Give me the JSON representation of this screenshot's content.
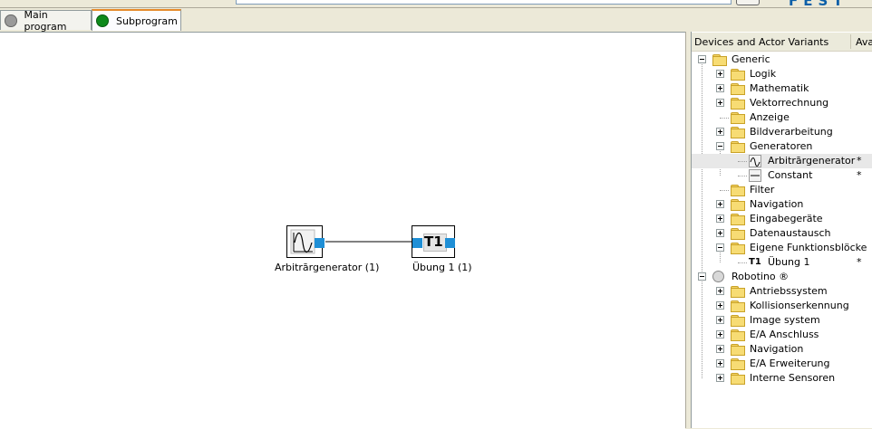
{
  "tabs": [
    {
      "label": "Main program",
      "icon": "gray-circle-icon",
      "color": "#9a9a9a",
      "active": false
    },
    {
      "label": "Subprogram",
      "icon": "green-circle-icon",
      "color": "#0e8a1c",
      "active": true
    }
  ],
  "brand": "FEST",
  "canvas": {
    "blocks": [
      {
        "label": "Arbitrārgenerator (1)",
        "icon": "sine-wave-icon"
      },
      {
        "label": "Übung 1 (1)",
        "icon_text": "T1"
      }
    ]
  },
  "panel": {
    "col1": "Devices and Actor Variants",
    "col2": "Ava",
    "tree": [
      {
        "label": "Generic",
        "depth": 0,
        "state": "expanded",
        "icon": "folder"
      },
      {
        "label": "Logik",
        "depth": 1,
        "state": "collapsed",
        "icon": "folder"
      },
      {
        "label": "Mathematik",
        "depth": 1,
        "state": "collapsed",
        "icon": "folder"
      },
      {
        "label": "Vektorrechnung",
        "depth": 1,
        "state": "collapsed",
        "icon": "folder"
      },
      {
        "label": "Anzeige",
        "depth": 1,
        "state": "leaf",
        "icon": "folder"
      },
      {
        "label": "Bildverarbeitung",
        "depth": 1,
        "state": "collapsed",
        "icon": "folder"
      },
      {
        "label": "Generatoren",
        "depth": 1,
        "state": "expanded",
        "icon": "folder"
      },
      {
        "label": "Arbitrārgenerator",
        "depth": 2,
        "state": "leaf",
        "icon": "sine-device",
        "mark": "*",
        "selected": true
      },
      {
        "label": "Constant",
        "depth": 2,
        "state": "leaf",
        "icon": "constant-device",
        "mark": "*"
      },
      {
        "label": "Filter",
        "depth": 1,
        "state": "leaf",
        "icon": "folder"
      },
      {
        "label": "Navigation",
        "depth": 1,
        "state": "collapsed",
        "icon": "folder"
      },
      {
        "label": "Eingabegeräte",
        "depth": 1,
        "state": "collapsed",
        "icon": "folder"
      },
      {
        "label": "Datenaustausch",
        "depth": 1,
        "state": "collapsed",
        "icon": "folder"
      },
      {
        "label": "Eigene Funktionsblöcke",
        "depth": 1,
        "state": "expanded",
        "icon": "folder"
      },
      {
        "label": "Übung 1",
        "depth": 2,
        "state": "leaf",
        "icon": "t1-device",
        "icon_text": "T1",
        "mark": "*"
      },
      {
        "label": "Robotino ®",
        "depth": 0,
        "state": "expanded",
        "icon": "robot"
      },
      {
        "label": "Antriebssystem",
        "depth": 1,
        "state": "collapsed",
        "icon": "folder"
      },
      {
        "label": "Kollisionserkennung",
        "depth": 1,
        "state": "collapsed",
        "icon": "folder"
      },
      {
        "label": "Image system",
        "depth": 1,
        "state": "collapsed",
        "icon": "folder"
      },
      {
        "label": "E/A Anschluss",
        "depth": 1,
        "state": "collapsed",
        "icon": "folder"
      },
      {
        "label": "Navigation",
        "depth": 1,
        "state": "collapsed",
        "icon": "folder"
      },
      {
        "label": "E/A Erweiterung",
        "depth": 1,
        "state": "collapsed",
        "icon": "folder"
      },
      {
        "label": "Interne Sensoren",
        "depth": 1,
        "state": "collapsed",
        "icon": "folder"
      }
    ]
  }
}
